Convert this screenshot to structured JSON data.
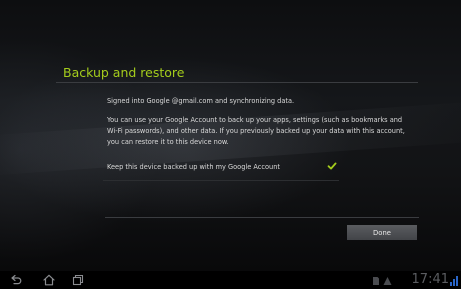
{
  "screen": {
    "title": "Backup and restore",
    "signed_in_text": "Signed into Google @gmail.com and synchronizing data.",
    "description": "You can use your Google Account to back up your apps, settings (such as bookmarks and Wi-Fi passwords), and other data. If you previously backed up your data with this account, you can restore it to this device now.",
    "checkbox": {
      "label": "Keep this device backed up with my Google Account",
      "checked": true
    },
    "done_label": "Done"
  },
  "status_bar": {
    "clock": "17:41"
  },
  "navigation": {
    "back_icon": "back-icon",
    "home_icon": "home-icon",
    "recents_icon": "recent-apps-icon"
  },
  "colors": {
    "accent": "#a4cc1c",
    "text": "#d9d9d9",
    "background": "#000000"
  }
}
